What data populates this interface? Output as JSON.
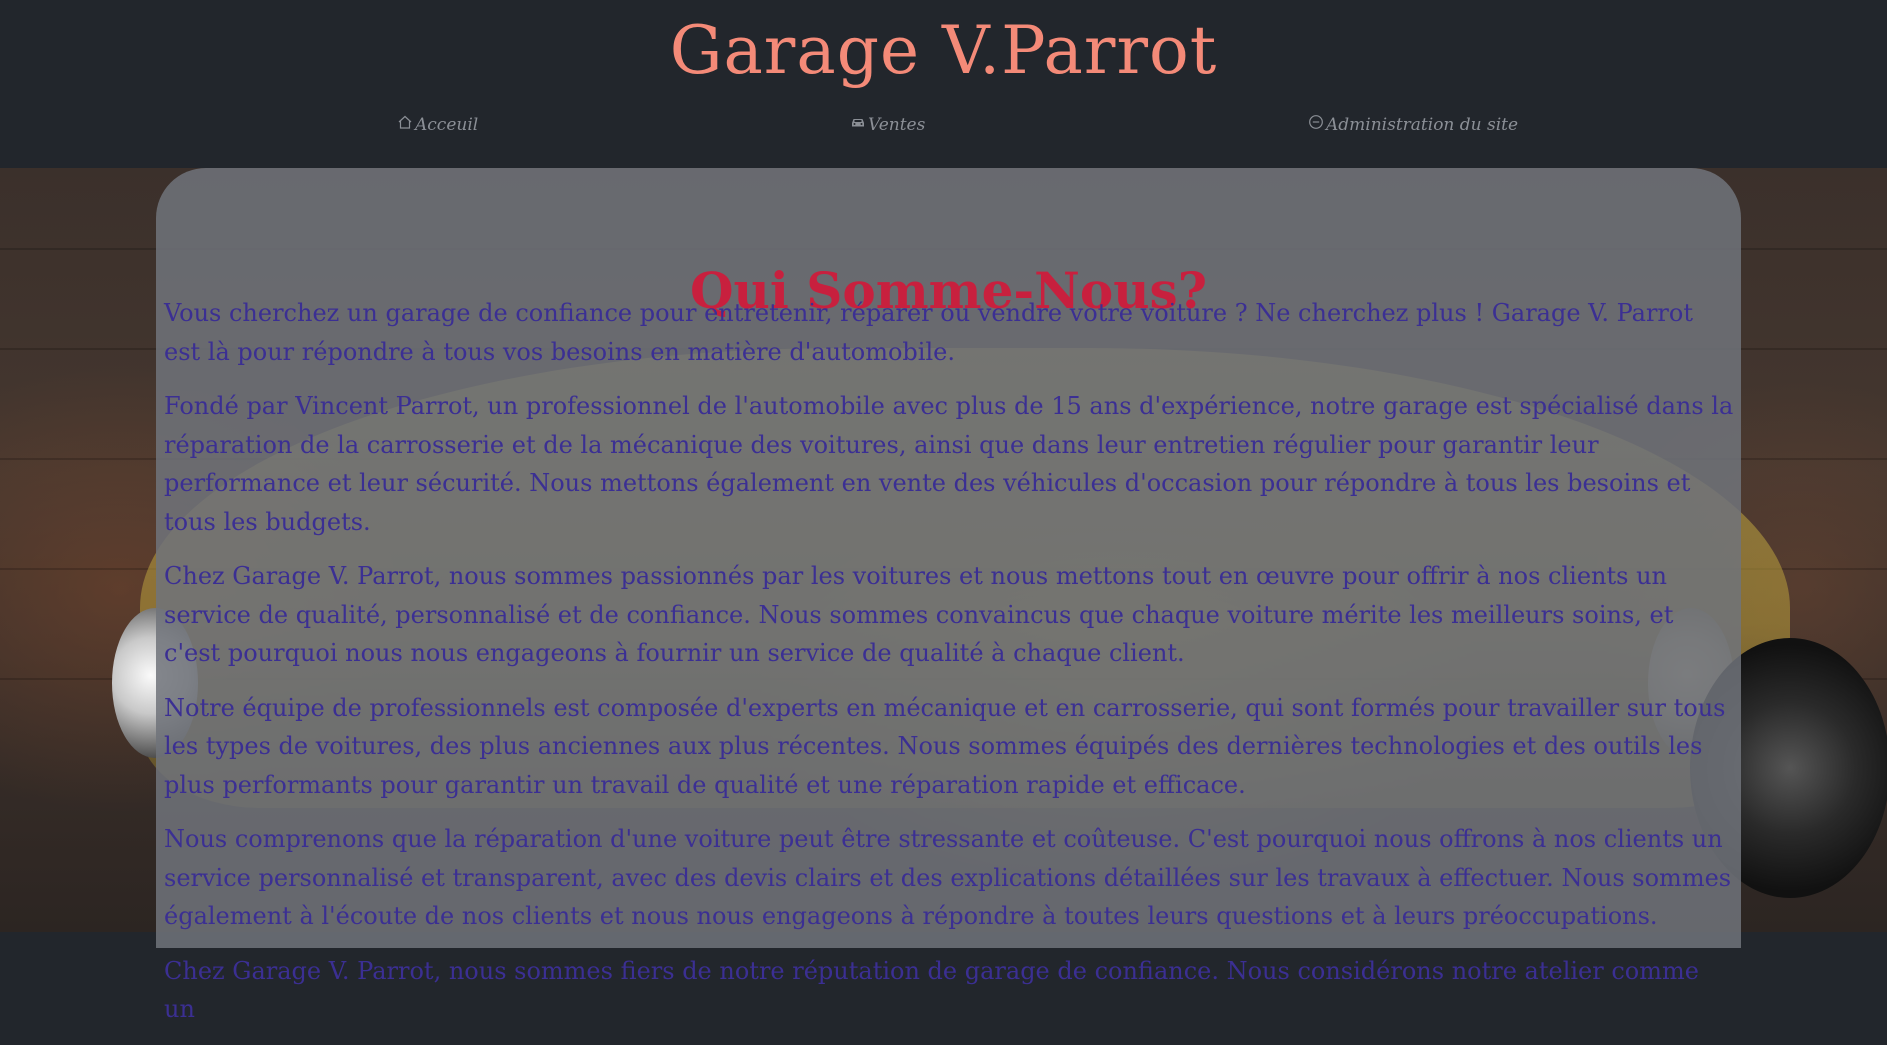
{
  "header": {
    "title": "Garage V.Parrot",
    "nav": [
      {
        "label": "Acceuil",
        "icon": "home-icon"
      },
      {
        "label": "Ventes",
        "icon": "car-icon"
      },
      {
        "label": "Administration du site",
        "icon": "dash-circle-icon"
      }
    ]
  },
  "main": {
    "title": "Qui Somme-Nous?",
    "paragraphs": [
      "Vous cherchez un garage de confiance pour entretenir, réparer ou vendre votre voiture ? Ne cherchez plus ! Garage V. Parrot est là pour répondre à tous vos besoins en matière d'automobile.",
      "Fondé par Vincent Parrot, un professionnel de l'automobile avec plus de 15 ans d'expérience, notre garage est spécialisé dans la réparation de la carrosserie et de la mécanique des voitures, ainsi que dans leur entretien régulier pour garantir leur performance et leur sécurité. Nous mettons également en vente des véhicules d'occasion pour répondre à tous les besoins et tous les budgets.",
      "Chez Garage V. Parrot, nous sommes passionnés par les voitures et nous mettons tout en œuvre pour offrir à nos clients un service de qualité, personnalisé et de confiance. Nous sommes convaincus que chaque voiture mérite les meilleurs soins, et c'est pourquoi nous nous engageons à fournir un service de qualité à chaque client.",
      "Notre équipe de professionnels est composée d'experts en mécanique et en carrosserie, qui sont formés pour travailler sur tous les types de voitures, des plus anciennes aux plus récentes. Nous sommes équipés des dernières technologies et des outils les plus performants pour garantir un travail de qualité et une réparation rapide et efficace.",
      "Nous comprenons que la réparation d'une voiture peut être stressante et coûteuse. C'est pourquoi nous offrons à nos clients un service personnalisé et transparent, avec des devis clairs et des explications détaillées sur les travaux à effectuer. Nous sommes également à l'écoute de nos clients et nous nous engageons à répondre à toutes leurs questions et à leurs préoccupations.",
      "Chez Garage V. Parrot, nous sommes fiers de notre réputation de garage de confiance. Nous considérons notre atelier comme un"
    ]
  },
  "colors": {
    "header_bg": "#22262c",
    "title": "#f48a78",
    "nav_text": "#8b8f96",
    "heading": "#c8203e",
    "body_text": "#3b2f93"
  }
}
